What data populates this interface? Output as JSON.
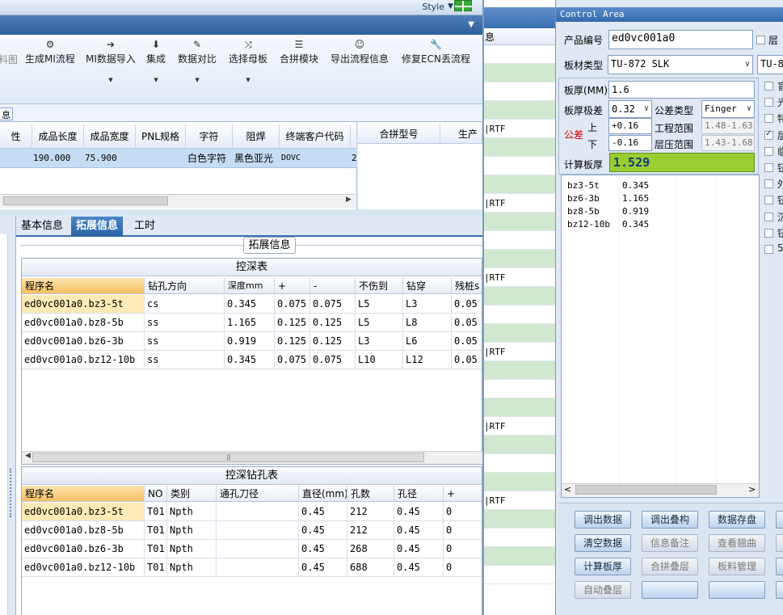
{
  "topbar": {
    "style_label": "Style"
  },
  "toolbar": {
    "cut_label": "料图",
    "buttons": [
      {
        "label": "生成MI流程",
        "icon": "⚙"
      },
      {
        "label": "MI数据导入",
        "icon": "➔"
      },
      {
        "label": "集成",
        "icon": "⬇"
      },
      {
        "label": "数据对比",
        "icon": "✎"
      },
      {
        "label": "选择母板",
        "icon": "⤨"
      },
      {
        "label": "合拼模块",
        "icon": "☰"
      },
      {
        "label": "导出流程信息",
        "icon": "☺"
      },
      {
        "label": "修复ECN丢流程",
        "icon": "🔧"
      }
    ]
  },
  "info_tab_cut": "息",
  "upper_grid": {
    "headers": [
      "性",
      "成品长度",
      "成品宽度",
      "PNL规格",
      "字符",
      "阻焊",
      "终端客户代码",
      ""
    ],
    "row": [
      "",
      "190.000",
      "75.900",
      "",
      "白色字符",
      "黑色亚光",
      "DOVC",
      "2"
    ]
  },
  "merge_grid": {
    "headers": [
      "合拼型号",
      "生产"
    ]
  },
  "tabs": {
    "basic": "基本信息",
    "expand": "拓展信息",
    "hours": "工时"
  },
  "group_title": "拓展信息",
  "depth_table": {
    "caption": "控深表",
    "headers": [
      "程序名",
      "钻孔方向",
      "深度mm",
      "+",
      "-",
      "不伤到",
      "钻穿",
      "残桩s"
    ],
    "rows": [
      [
        "ed0vc001a0.bz3-5t",
        "cs",
        "0.345",
        "0.075",
        "0.075",
        "L5",
        "L3",
        "0.05"
      ],
      [
        "ed0vc001a0.bz8-5b",
        "ss",
        "1.165",
        "0.125",
        "0.125",
        "L5",
        "L8",
        "0.05"
      ],
      [
        "ed0vc001a0.bz6-3b",
        "ss",
        "0.919",
        "0.125",
        "0.125",
        "L3",
        "L6",
        "0.05"
      ],
      [
        "ed0vc001a0.bz12-10b",
        "ss",
        "0.345",
        "0.075",
        "0.075",
        "L10",
        "L12",
        "0.05"
      ]
    ]
  },
  "hole_table": {
    "caption": "控深钻孔表",
    "headers": [
      "程序名",
      "NO",
      "类别",
      "通孔刀径",
      "直径(mm)",
      "孔数",
      "孔径",
      "+"
    ],
    "rows": [
      [
        "ed0vc001a0.bz3-5t",
        "T01",
        "Npth",
        "",
        "0.45",
        "212",
        "0.45",
        "0"
      ],
      [
        "ed0vc001a0.bz8-5b",
        "T01",
        "Npth",
        "",
        "0.45",
        "212",
        "0.45",
        "0"
      ],
      [
        "ed0vc001a0.bz6-3b",
        "T01",
        "Npth",
        "",
        "0.45",
        "268",
        "0.45",
        "0"
      ],
      [
        "ed0vc001a0.bz12-10b",
        "T01",
        "Npth",
        "",
        "0.45",
        "688",
        "0.45",
        "0"
      ]
    ]
  },
  "middle": {
    "header": "息",
    "rows": [
      "",
      "",
      "",
      "",
      "|RTF",
      "",
      "",
      "",
      "|RTF",
      "",
      "",
      "",
      "|RTF",
      "",
      "",
      "",
      "|RTF",
      "",
      "",
      "",
      "|RTF",
      "",
      "",
      "",
      "|RTF",
      "",
      "",
      "",
      ""
    ]
  },
  "control": {
    "title": "Control Area",
    "product_no_label": "产品编号",
    "product_no": "ed0vc001a0",
    "layer_chk_label": "层",
    "board_type_label": "板材类型",
    "board_type": "TU-872 SLK",
    "board_type2": "TU-8",
    "thickness_label": "板厚(MM)",
    "thickness": "1.6",
    "tol_grade_label": "板厚极差",
    "tol_grade": "0.32",
    "tol_type_label": "公差类型",
    "tol_type": "Finger",
    "tol_label": "公差",
    "upper_label": "上",
    "lower_label": "下",
    "upper_val": "+0.16",
    "lower_val": "-0.16",
    "eng_range_label": "工程范围",
    "eng_range": "1.48-1.63",
    "press_range_label": "层压范围",
    "press_range": "1.43-1.68",
    "calc_label": "计算板厚",
    "calc_value": "1.529",
    "stack_list": [
      {
        "name": "bz3-5t",
        "val": "0.345"
      },
      {
        "name": "bz6-3b",
        "val": "1.165"
      },
      {
        "name": "bz8-5b",
        "val": "0.919"
      },
      {
        "name": "bz12-10b",
        "val": "0.345"
      }
    ],
    "right_checks": [
      "盲",
      "光",
      "特",
      "层",
      "临",
      "钮",
      "外",
      "钮",
      "沉",
      "钮",
      "5"
    ],
    "buttons": {
      "r1": [
        "调出数据",
        "调出叠构",
        "数据存盘"
      ],
      "r2": [
        "清空数据",
        "信息备注",
        "查看翘曲"
      ],
      "r3": [
        "计算板厚",
        "合拼叠层",
        "板料管理"
      ],
      "r4": [
        "自动叠层",
        "",
        ""
      ]
    }
  }
}
